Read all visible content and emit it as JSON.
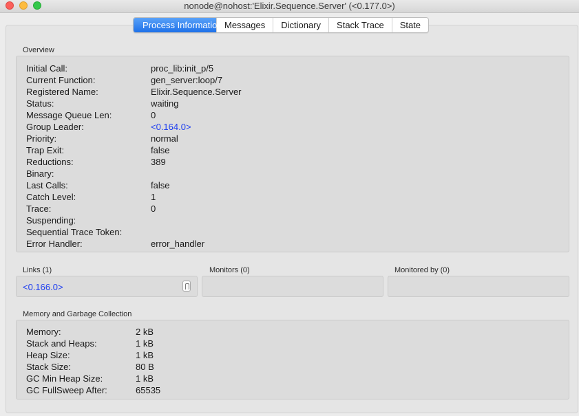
{
  "window": {
    "title": "nonode@nohost:'Elixir.Sequence.Server' (<0.177.0>)"
  },
  "tabs": [
    {
      "label": "Process Information",
      "active": true
    },
    {
      "label": "Messages",
      "active": false
    },
    {
      "label": "Dictionary",
      "active": false
    },
    {
      "label": "Stack Trace",
      "active": false
    },
    {
      "label": "State",
      "active": false
    }
  ],
  "overview": {
    "label": "Overview",
    "rows": [
      {
        "key": "Initial Call:",
        "value": "proc_lib:init_p/5"
      },
      {
        "key": "Current Function:",
        "value": "gen_server:loop/7"
      },
      {
        "key": "Registered Name:",
        "value": "Elixir.Sequence.Server"
      },
      {
        "key": "Status:",
        "value": "waiting"
      },
      {
        "key": "Message Queue Len:",
        "value": "0"
      },
      {
        "key": "Group Leader:",
        "value": "<0.164.0>"
      },
      {
        "key": "Priority:",
        "value": "normal"
      },
      {
        "key": "Trap Exit:",
        "value": "false"
      },
      {
        "key": "Reductions:",
        "value": "389"
      },
      {
        "key": "Binary:",
        "value": ""
      },
      {
        "key": "Last Calls:",
        "value": "false"
      },
      {
        "key": "Catch Level:",
        "value": "1"
      },
      {
        "key": "Trace:",
        "value": "0"
      },
      {
        "key": "Suspending:",
        "value": ""
      },
      {
        "key": "Sequential Trace Token:",
        "value": ""
      },
      {
        "key": "Error Handler:",
        "value": "error_handler"
      }
    ]
  },
  "links": {
    "label": "Links (1)",
    "items": [
      "<0.166.0>"
    ]
  },
  "monitors": {
    "label": "Monitors (0)"
  },
  "monitored_by": {
    "label": "Monitored by (0)"
  },
  "memory": {
    "label": "Memory and Garbage Collection",
    "rows": [
      {
        "key": "Memory:",
        "value": "2 kB"
      },
      {
        "key": "Stack and Heaps:",
        "value": "1 kB"
      },
      {
        "key": "Heap Size:",
        "value": "1 kB"
      },
      {
        "key": "Stack Size:",
        "value": "80 B"
      },
      {
        "key": "GC Min Heap Size:",
        "value": "1 kB"
      },
      {
        "key": "GC FullSweep After:",
        "value": "65535"
      }
    ]
  },
  "colors": {
    "link": "#1f3ff0",
    "tab_active": "#1e71e9"
  }
}
